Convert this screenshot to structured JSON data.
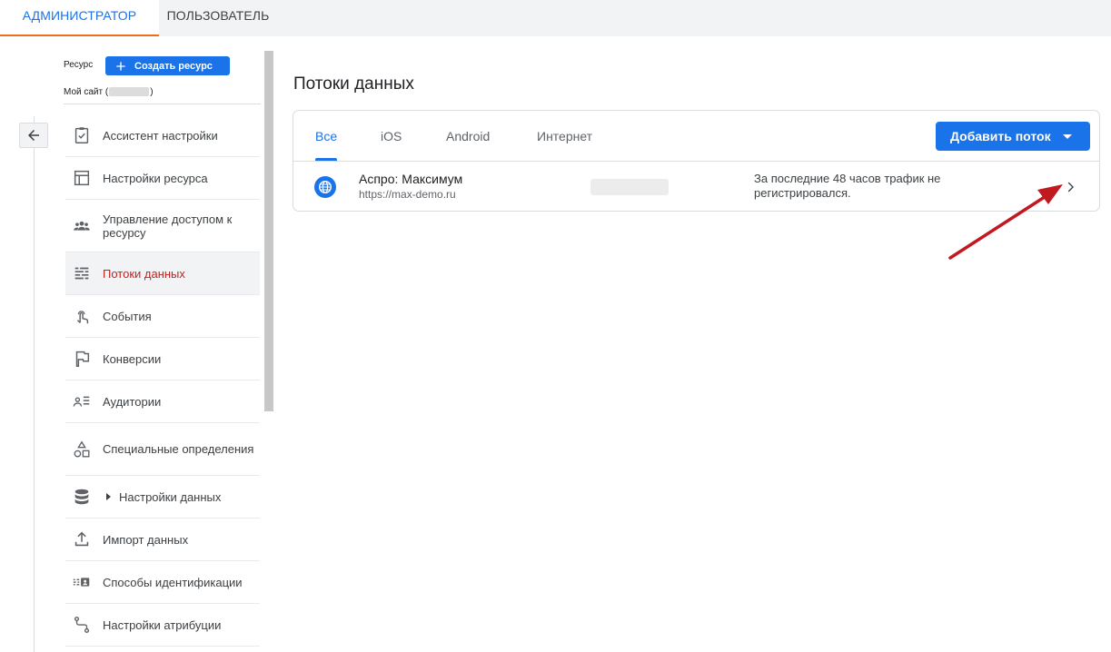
{
  "top_tabs": [
    {
      "label": "АДМИНИСТРАТОР"
    },
    {
      "label": "ПОЛЬЗОВАТЕЛЬ"
    }
  ],
  "resource": {
    "label": "Ресурс",
    "create_label": "Создать ресурс",
    "site_name": "Мой сайт (",
    "site_name_end": ")"
  },
  "sidebar": {
    "items": [
      {
        "label": "Ассистент настройки",
        "icon": "checklist-icon"
      },
      {
        "label": "Настройки ресурса",
        "icon": "layout-icon"
      },
      {
        "label": "Управление доступом к ресурсу",
        "icon": "people-icon"
      },
      {
        "label": "Потоки данных",
        "icon": "data-streams-icon",
        "active": true
      },
      {
        "label": "События",
        "icon": "touch-icon"
      },
      {
        "label": "Конверсии",
        "icon": "flag-icon"
      },
      {
        "label": "Аудитории",
        "icon": "audience-icon"
      },
      {
        "label": "Специальные определения",
        "icon": "shapes-icon"
      },
      {
        "label": "Настройки данных",
        "icon": "database-icon"
      },
      {
        "label": "Импорт данных",
        "icon": "upload-icon"
      },
      {
        "label": "Способы идентификации",
        "icon": "identity-icon"
      },
      {
        "label": "Настройки атрибуции",
        "icon": "route-icon"
      }
    ]
  },
  "main": {
    "title": "Потоки данных",
    "tabs": [
      {
        "label": "Все"
      },
      {
        "label": "iOS"
      },
      {
        "label": "Android"
      },
      {
        "label": "Интернет"
      }
    ],
    "add_stream_label": "Добавить поток",
    "stream": {
      "name": "Аспро: Максимум",
      "url": "https://max-demo.ru",
      "status": "За последние 48 часов трафик не регистрировался."
    }
  },
  "colors": {
    "accent": "#1a73e8",
    "active_nav": "#c5221f",
    "annotation": "#c0191f"
  }
}
